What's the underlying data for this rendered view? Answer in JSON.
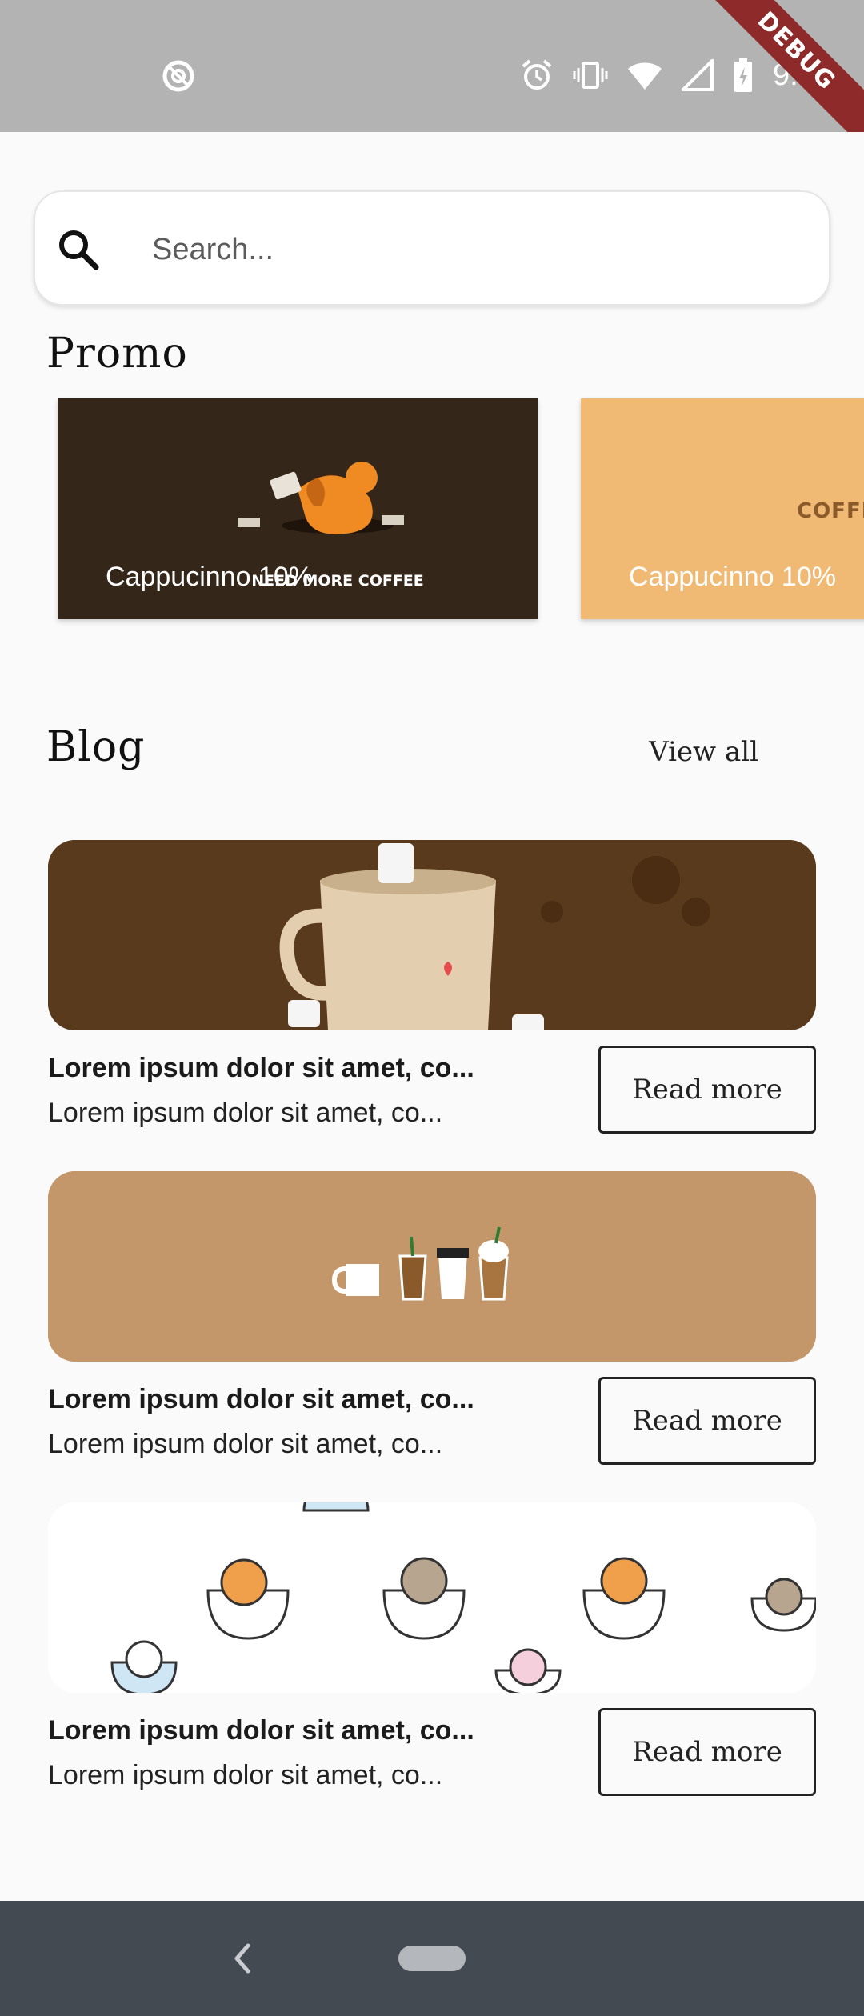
{
  "status_bar": {
    "time": "9:16",
    "debug_label": "DEBUG",
    "icons": [
      "sync-off-icon",
      "alarm-icon",
      "vibrate-icon",
      "wifi-icon",
      "signal-icon",
      "battery-icon"
    ]
  },
  "search": {
    "placeholder": "Search...",
    "icon": "search-icon"
  },
  "promo": {
    "heading": "Promo",
    "items": [
      {
        "label": "Cappucinno 10%",
        "art_text": "NEED MORE COFFEE",
        "bg": "#35261a"
      },
      {
        "label": "Cappucinno 10%",
        "art_text": "COFFEE",
        "bg": "#f0b974"
      }
    ]
  },
  "blog": {
    "heading": "Blog",
    "view_all": "View all",
    "items": [
      {
        "title": "Lorem ipsum dolor sit amet, co...",
        "subtitle": "Lorem ipsum dolor sit amet, co...",
        "button": "Read more",
        "image": "marshmallow-mug"
      },
      {
        "title": "Lorem ipsum dolor sit amet, co...",
        "subtitle": "Lorem ipsum dolor sit amet, co...",
        "button": "Read more",
        "image": "coffee-cups"
      },
      {
        "title": "Lorem ipsum dolor sit amet, co...",
        "subtitle": "Lorem ipsum dolor sit amet, co...",
        "button": "Read more",
        "image": "cats-in-cups"
      }
    ]
  },
  "nav_bar": {
    "icons": [
      "back-icon",
      "home-pill"
    ]
  },
  "colors": {
    "status_bar": "#b3b3b3",
    "background": "#fafafa",
    "nav_bar": "#434a51",
    "debug_ribbon": "#8e2a2a"
  }
}
